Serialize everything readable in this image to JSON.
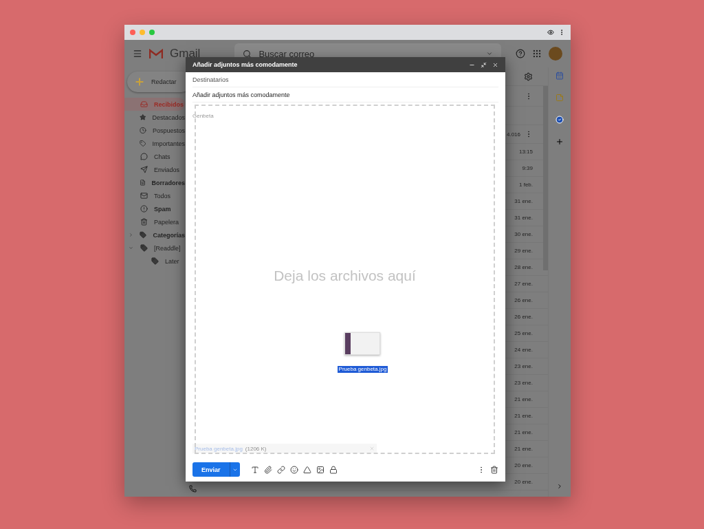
{
  "header": {
    "app_name": "Gmail",
    "search": {
      "placeholder": "Buscar correo"
    }
  },
  "compose_button": "Redactar",
  "sidebar": {
    "items": [
      {
        "label": "Recibidos",
        "selected": true,
        "bold": true
      },
      {
        "label": "Destacados",
        "selected": false,
        "bold": false
      },
      {
        "label": "Pospuestos",
        "selected": false,
        "bold": false
      },
      {
        "label": "Importantes",
        "selected": false,
        "bold": false
      },
      {
        "label": "Chats",
        "selected": false,
        "bold": false
      },
      {
        "label": "Enviados",
        "selected": false,
        "bold": false
      },
      {
        "label": "Borradores",
        "selected": false,
        "bold": true
      },
      {
        "label": "Todos",
        "selected": false,
        "bold": false
      },
      {
        "label": "Spam",
        "selected": false,
        "bold": true
      },
      {
        "label": "Papelera",
        "selected": false,
        "bold": false
      },
      {
        "label": "Categorías",
        "selected": false,
        "bold": true,
        "expanded": false
      },
      {
        "label": "[Readdle]",
        "selected": false,
        "bold": false,
        "expanded": true,
        "children": [
          {
            "label": "Later",
            "selected": false,
            "bold": false
          }
        ]
      }
    ]
  },
  "list": {
    "count": "4.016",
    "dates": [
      "13:15",
      "9:39",
      "1 feb.",
      "31 ene.",
      "31 ene.",
      "30 ene.",
      "29 ene.",
      "28 ene.",
      "27 ene.",
      "26 ene.",
      "26 ene.",
      "25 ene.",
      "24 ene.",
      "23 ene.",
      "23 ene.",
      "21 ene.",
      "21 ene.",
      "21 ene.",
      "21 ene.",
      "20 ene.",
      "20 ene."
    ]
  },
  "compose": {
    "title": "Añadir adjuntos más comodamente",
    "to_placeholder": "Destinatarios",
    "subject": "Añadir adjuntos más comodamente",
    "body": "Genbeta",
    "drop_text": "Deja los archivos aquí",
    "dragged_file": "Prueba genbeta.jpg",
    "attachment": {
      "name": "Prueba genbeta.jpg",
      "size": "(1206 K)"
    },
    "send_button": "Enviar"
  }
}
